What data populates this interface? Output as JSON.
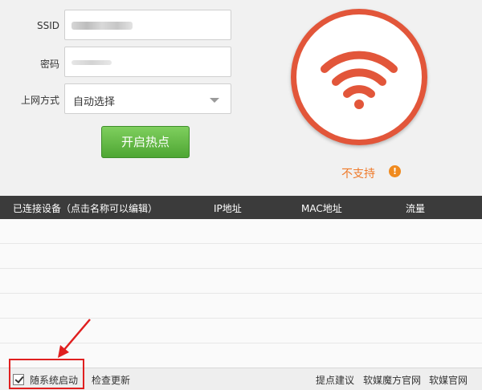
{
  "form": {
    "ssid_label": "SSID",
    "password_label": "密码",
    "network_mode_label": "上网方式",
    "network_mode_value": "自动选择",
    "start_button_label": "开启热点"
  },
  "status": {
    "text": "不支持",
    "warn_glyph": "!"
  },
  "table": {
    "columns": [
      "已连接设备（点击名称可以编辑）",
      "IP地址",
      "MAC地址",
      "流量"
    ],
    "rows": []
  },
  "footer": {
    "autostart_label": "随系统启动",
    "autostart_checked": true,
    "check_update": "检查更新",
    "feedback": "提点建议",
    "official_site": "软媒魔方官网",
    "ruanmei_site": "软媒官网"
  },
  "colors": {
    "accent_orange": "#e2563a",
    "start_green": "#4ea633",
    "annotation_red": "#e01f1f"
  }
}
